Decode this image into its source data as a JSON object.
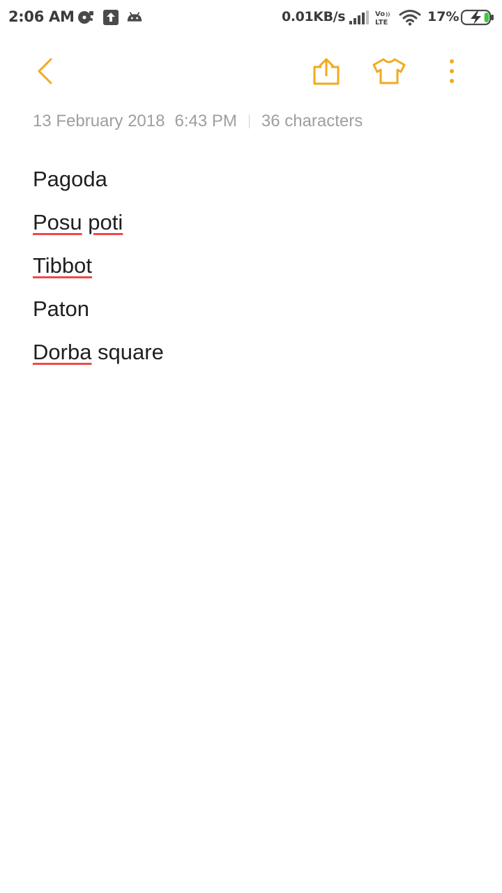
{
  "status_bar": {
    "time": "2:06 AM",
    "notification_icons": [
      "sync-disc-icon",
      "upload-icon",
      "android-debug-icon"
    ],
    "network_speed": "0.01KB/s",
    "signal_icon": "cell-signal-icon",
    "volte_icon": "volte-lte-icon",
    "wifi_icon": "wifi-icon",
    "battery_percent": "17%",
    "battery_icon": "battery-charging-icon",
    "battery_level": 0.17
  },
  "toolbar": {
    "back_icon": "chevron-left-icon",
    "share_icon": "share-icon",
    "theme_icon": "tshirt-icon",
    "more_icon": "more-vertical-icon",
    "accent_color": "#F2A91E"
  },
  "meta": {
    "date": "13 February 2018",
    "time": "6:43 PM",
    "char_count": "36 characters"
  },
  "note": {
    "lines": [
      {
        "segments": [
          {
            "text": "Pagoda",
            "misspelled": false
          }
        ]
      },
      {
        "segments": [
          {
            "text": "Posu",
            "misspelled": true
          },
          {
            "text": " ",
            "misspelled": false
          },
          {
            "text": "poti",
            "misspelled": true
          }
        ]
      },
      {
        "segments": [
          {
            "text": "Tibbot",
            "misspelled": true
          }
        ]
      },
      {
        "segments": [
          {
            "text": "Paton",
            "misspelled": false
          }
        ]
      },
      {
        "segments": [
          {
            "text": "Dorba",
            "misspelled": true
          },
          {
            "text": " square",
            "misspelled": false
          }
        ]
      }
    ],
    "text_color": "#1F1F1F",
    "spellcheck_color": "#F04848"
  }
}
